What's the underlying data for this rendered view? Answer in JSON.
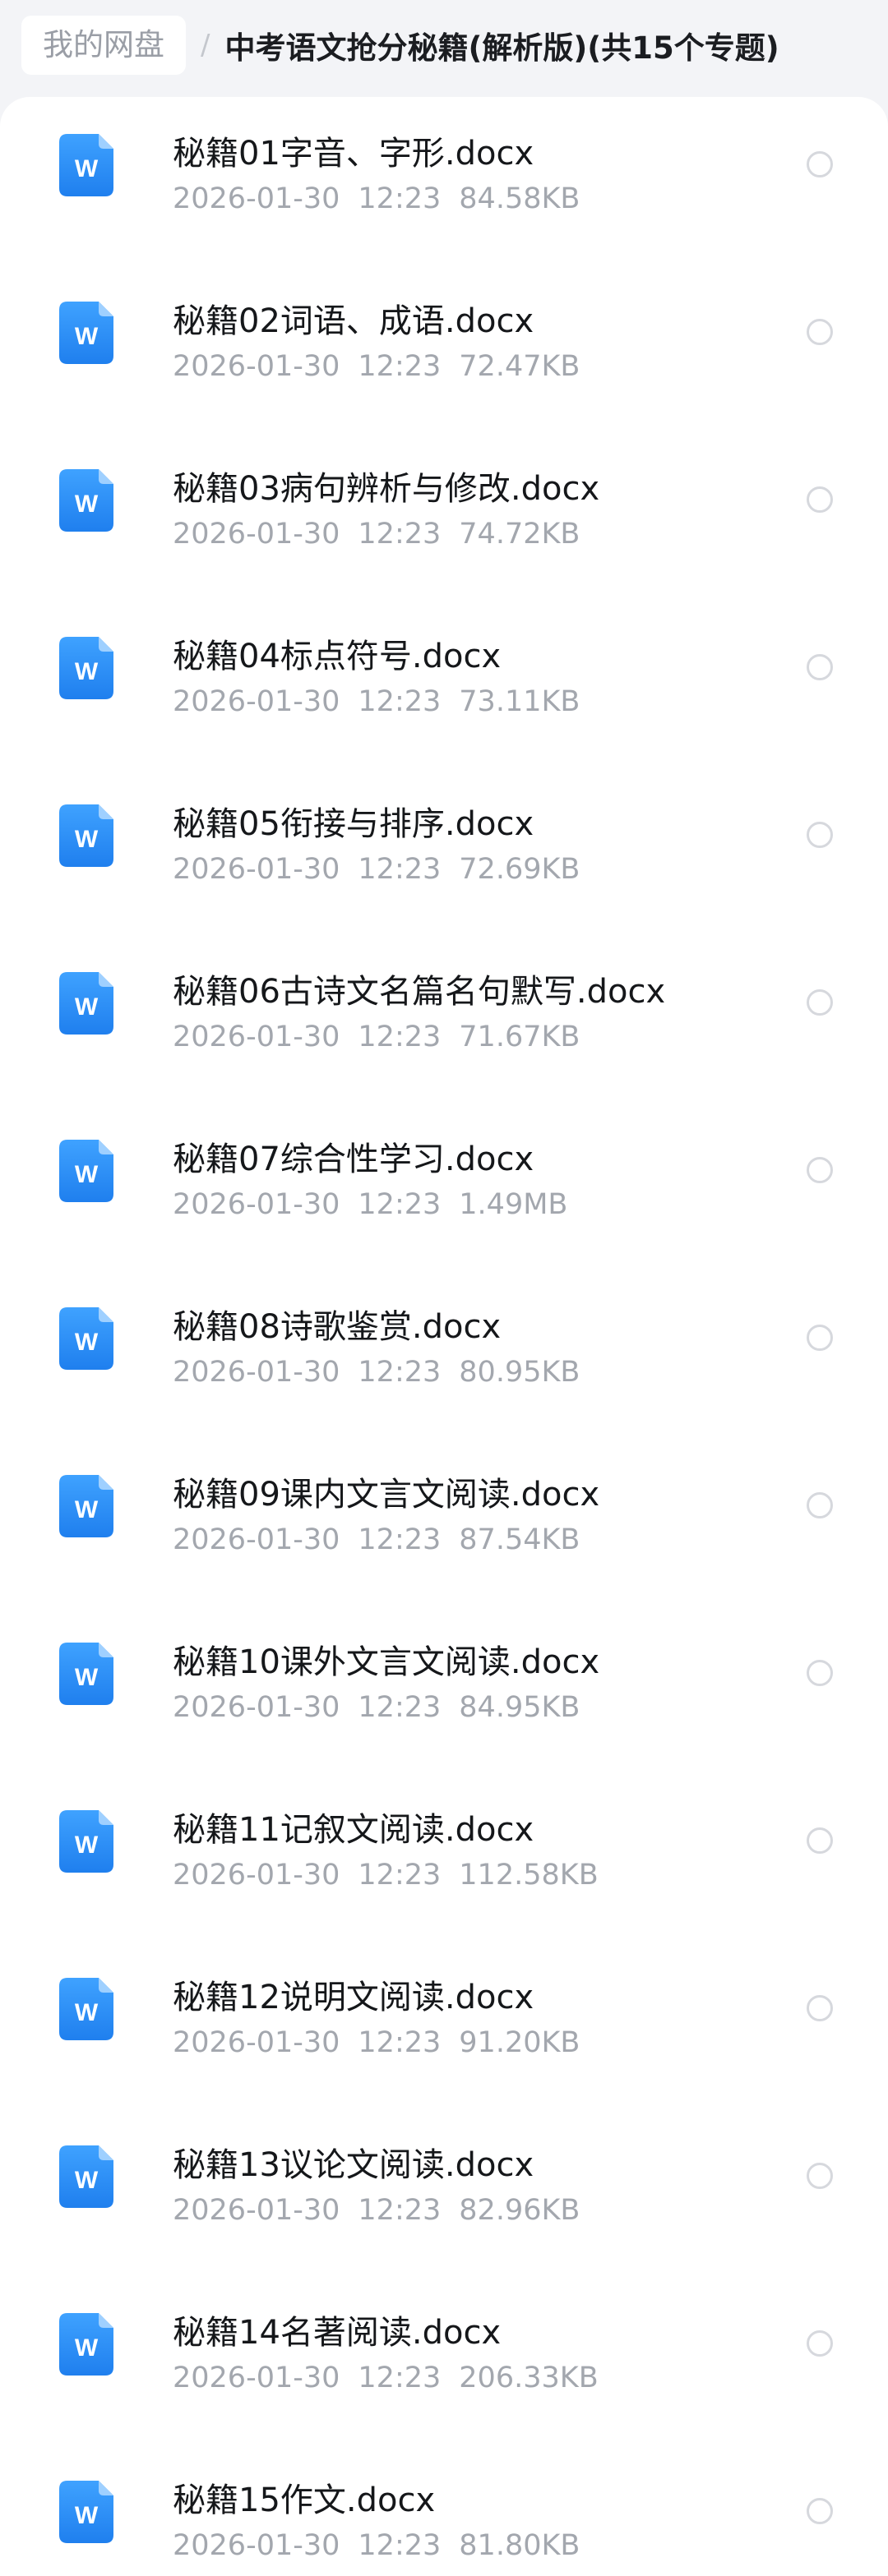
{
  "breadcrumb": {
    "root": "我的网盘",
    "separator": "/",
    "current": "中考语文抢分秘籍(解析版)(共15个专题)"
  },
  "icons": {
    "file_type": "word-doc-icon",
    "file_letter": "W",
    "accent_color": "#2a8cf5"
  },
  "files": [
    {
      "name": "秘籍01字音、字形.docx",
      "date": "2026-01-30",
      "time": "12:23",
      "size": "84.58KB"
    },
    {
      "name": "秘籍02词语、成语.docx",
      "date": "2026-01-30",
      "time": "12:23",
      "size": "72.47KB"
    },
    {
      "name": "秘籍03病句辨析与修改.docx",
      "date": "2026-01-30",
      "time": "12:23",
      "size": "74.72KB"
    },
    {
      "name": "秘籍04标点符号.docx",
      "date": "2026-01-30",
      "time": "12:23",
      "size": "73.11KB"
    },
    {
      "name": "秘籍05衔接与排序.docx",
      "date": "2026-01-30",
      "time": "12:23",
      "size": "72.69KB"
    },
    {
      "name": "秘籍06古诗文名篇名句默写.docx",
      "date": "2026-01-30",
      "time": "12:23",
      "size": "71.67KB"
    },
    {
      "name": "秘籍07综合性学习.docx",
      "date": "2026-01-30",
      "time": "12:23",
      "size": "1.49MB"
    },
    {
      "name": "秘籍08诗歌鉴赏.docx",
      "date": "2026-01-30",
      "time": "12:23",
      "size": "80.95KB"
    },
    {
      "name": "秘籍09课内文言文阅读.docx",
      "date": "2026-01-30",
      "time": "12:23",
      "size": "87.54KB"
    },
    {
      "name": "秘籍10课外文言文阅读.docx",
      "date": "2026-01-30",
      "time": "12:23",
      "size": "84.95KB"
    },
    {
      "name": "秘籍11记叙文阅读.docx",
      "date": "2026-01-30",
      "time": "12:23",
      "size": "112.58KB"
    },
    {
      "name": "秘籍12说明文阅读.docx",
      "date": "2026-01-30",
      "time": "12:23",
      "size": "91.20KB"
    },
    {
      "name": "秘籍13议论文阅读.docx",
      "date": "2026-01-30",
      "time": "12:23",
      "size": "82.96KB"
    },
    {
      "name": "秘籍14名著阅读.docx",
      "date": "2026-01-30",
      "time": "12:23",
      "size": "206.33KB"
    },
    {
      "name": "秘籍15作文.docx",
      "date": "2026-01-30",
      "time": "12:23",
      "size": "81.80KB"
    }
  ]
}
